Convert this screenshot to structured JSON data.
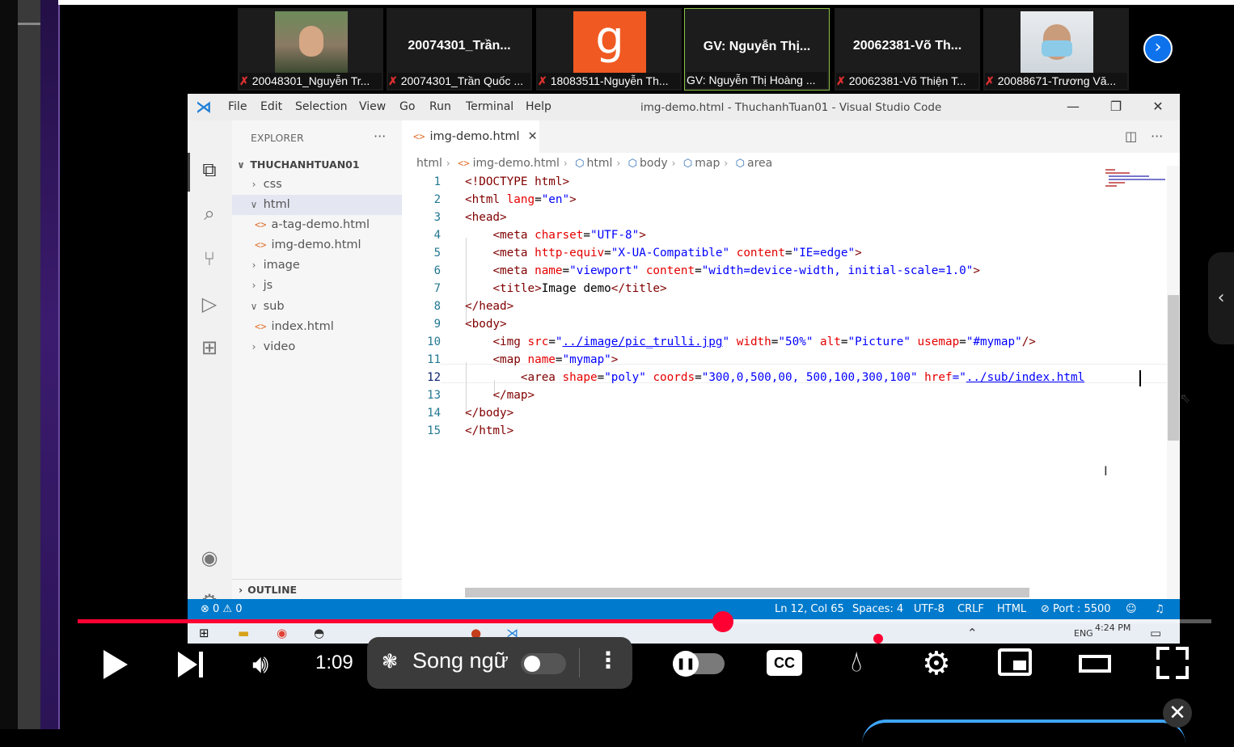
{
  "participants": [
    {
      "name_overlay": "",
      "caption": "20048301_Nguyễn Tr...",
      "muted": true,
      "kind": "photo"
    },
    {
      "name_overlay": "20074301_Trần...",
      "caption": "20074301_Trần Quốc ...",
      "muted": true,
      "kind": "name"
    },
    {
      "name_overlay": "g",
      "caption": "18083511-Nguyễn Th...",
      "muted": true,
      "kind": "avatar"
    },
    {
      "name_overlay": "GV: Nguyễn Thị...",
      "caption": "GV: Nguyễn Thị Hoàng ...",
      "muted": false,
      "kind": "name"
    },
    {
      "name_overlay": "20062381-Võ Th...",
      "caption": "20062381-Võ Thiện T...",
      "muted": true,
      "kind": "name"
    },
    {
      "name_overlay": "",
      "caption": "20088671-Trương Vă...",
      "muted": true,
      "kind": "photo-mask"
    }
  ],
  "vscode": {
    "menu": [
      "File",
      "Edit",
      "Selection",
      "View",
      "Go",
      "Run",
      "Terminal",
      "Help"
    ],
    "window_title": "img-demo.html - ThuchanhTuan01 - Visual Studio Code",
    "explorer": {
      "header": "EXPLORER",
      "root": "THUCHANHTUAN01",
      "items": [
        {
          "label": "css",
          "type": "folder",
          "open": false,
          "depth": 1
        },
        {
          "label": "html",
          "type": "folder",
          "open": true,
          "depth": 1
        },
        {
          "label": "a-tag-demo.html",
          "type": "file",
          "depth": 2
        },
        {
          "label": "img-demo.html",
          "type": "file",
          "depth": 2
        },
        {
          "label": "image",
          "type": "folder",
          "open": false,
          "depth": 1
        },
        {
          "label": "js",
          "type": "folder",
          "open": false,
          "depth": 1
        },
        {
          "label": "sub",
          "type": "folder",
          "open": true,
          "depth": 1
        },
        {
          "label": "index.html",
          "type": "file",
          "depth": 2
        },
        {
          "label": "video",
          "type": "folder",
          "open": false,
          "depth": 1
        }
      ],
      "outline": "OUTLINE"
    },
    "tab": "img-demo.html",
    "breadcrumb": [
      "html",
      "img-demo.html",
      "html",
      "body",
      "map",
      "area"
    ],
    "line_numbers": [
      "1",
      "2",
      "3",
      "4",
      "5",
      "6",
      "7",
      "8",
      "9",
      "10",
      "11",
      "12",
      "13",
      "14",
      "15"
    ],
    "code": {
      "l1": "<!DOCTYPE html>",
      "l2_tag": "<html",
      "l2_attr": " lang",
      "l2_val": "\"en\"",
      "l2_end": ">",
      "l3": "<head>",
      "l4_tag": "<meta",
      "l4_attr": " charset",
      "l4_val": "\"UTF-8\"",
      "l4_end": ">",
      "l5_tag": "<meta",
      "l5_attr1": " http-equiv",
      "l5_val1": "\"X-UA-Compatible\"",
      "l5_attr2": " content",
      "l5_val2": "\"IE=edge\"",
      "l5_end": ">",
      "l6_tag": "<meta",
      "l6_attr1": " name",
      "l6_val1": "\"viewport\"",
      "l6_attr2": " content",
      "l6_val2": "\"width=device-width, initial-scale=1.0\"",
      "l6_end": ">",
      "l7_open": "<title>",
      "l7_text": "Image demo",
      "l7_close": "</title>",
      "l8": "</head>",
      "l9": "<body>",
      "l10_tag": "<img",
      "l10_attr1": " src",
      "l10_q1": "\"",
      "l10_link": "../image/pic_trulli.jpg",
      "l10_q2": "\"",
      "l10_attr2": " width",
      "l10_val2": "\"50%\"",
      "l10_attr3": " alt",
      "l10_val3": "\"Picture\"",
      "l10_attr4": " usemap",
      "l10_val4": "\"#mymap\"",
      "l10_end": "/>",
      "l11_tag": "<map",
      "l11_attr": " name",
      "l11_val": "\"mymap\"",
      "l11_end": ">",
      "l12_tag": "<area",
      "l12_attr1": " shape",
      "l12_val1": "\"poly\"",
      "l12_attr2": " coords",
      "l12_val2": "\"300,0,500,00, 500,100,300,100\"",
      "l12_attr3": " href",
      "l12_eq": "=\"",
      "l12_link": "../sub/index.html",
      "l13": "</map>",
      "l14": "</body>",
      "l15": "</html>"
    },
    "status": {
      "problems": "⊗ 0 ⚠ 0",
      "position": "Ln 12, Col 65",
      "spaces": "Spaces: 4",
      "encoding": "UTF-8",
      "eol": "CRLF",
      "language": "HTML",
      "port": "⊘ Port : 5500"
    }
  },
  "taskbar": {
    "lang": "ENG",
    "time": "4:24 PM"
  },
  "player": {
    "time": "1:09",
    "subtitle_lang": "Song ngữ",
    "progress": 0.569,
    "cc_label": "CC",
    "colors": {
      "progress": "#ff0033",
      "blue_button": "#0e72ed"
    }
  }
}
